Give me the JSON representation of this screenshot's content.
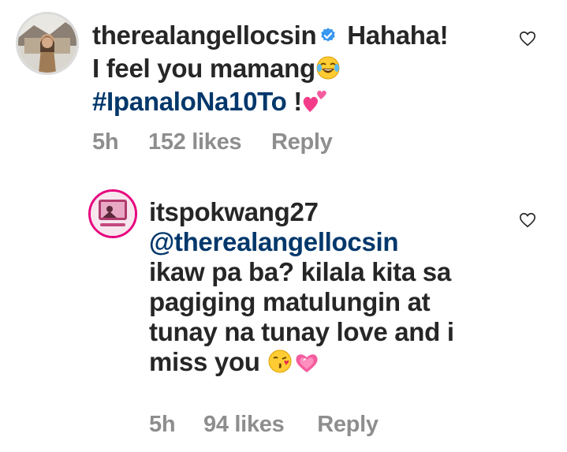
{
  "comments": [
    {
      "username": "therealangellocsin",
      "verified": true,
      "line1_text": "Hahaha!",
      "line2_text": "I feel you mamang",
      "line2_emoji": "tears-of-joy",
      "hashtag": "#IpanaloNa10To",
      "line3_suffix": " !",
      "line3_emoji": "two-hearts",
      "time": "5h",
      "likes": "152 likes",
      "reply_label": "Reply"
    },
    {
      "username": "itspokwang27",
      "mention": "@therealangellocsin",
      "lines": [
        "ikaw pa ba? kilala kita sa",
        "pagiging matulungin at",
        "tunay na tunay love and i"
      ],
      "last_line": "miss you",
      "last_emojis": [
        "face-blowing-a-kiss",
        "sparkling-heart"
      ],
      "time": "5h",
      "likes": "94 likes",
      "reply_label": "Reply"
    }
  ],
  "colors": {
    "text": "#262626",
    "link": "#00376b",
    "meta": "#8e8e8e",
    "verified": "#3897f0"
  }
}
